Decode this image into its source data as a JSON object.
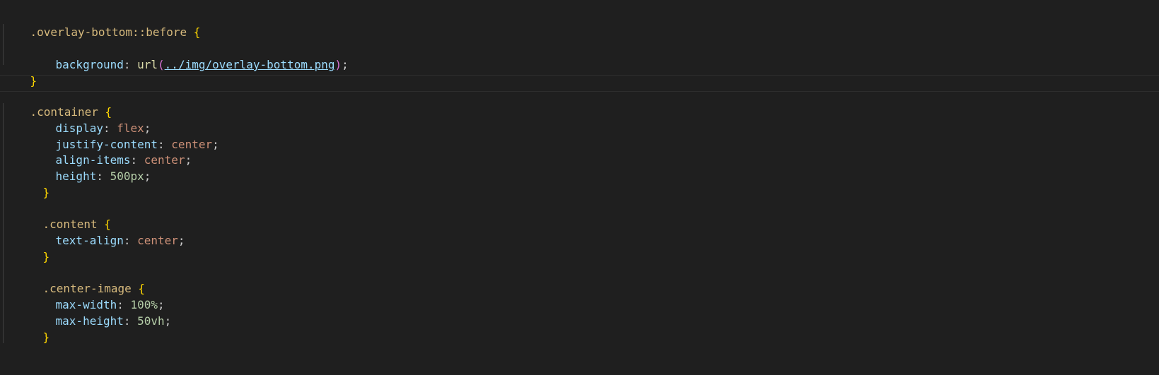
{
  "editor": {
    "blocks": {
      "overlay_bottom": {
        "selector": ".overlay-bottom::before",
        "open": "{",
        "close": "}",
        "decls": [
          {
            "prop": "background",
            "fn": "url",
            "arg": "../img/overlay-bottom.png"
          }
        ]
      },
      "container": {
        "selector": ".container",
        "open": "{",
        "close": "}",
        "decls": [
          {
            "prop": "display",
            "value": "flex"
          },
          {
            "prop": "justify-content",
            "value": "center"
          },
          {
            "prop": "align-items",
            "value": "center"
          },
          {
            "prop": "height",
            "value": "500px"
          }
        ]
      },
      "content": {
        "selector": ".content",
        "open": "{",
        "close": "}",
        "decls": [
          {
            "prop": "text-align",
            "value": "center"
          }
        ]
      },
      "center_image": {
        "selector": ".center-image",
        "open": "{",
        "close": "}",
        "decls": [
          {
            "prop": "max-width",
            "value": "100%"
          },
          {
            "prop": "max-height",
            "value": "50vh"
          }
        ]
      }
    },
    "colors": {
      "background": "#1f1f1f",
      "selector": "#d7ba7d",
      "brace": "#ffd700",
      "property": "#9cdcfe",
      "string_value": "#ce9178",
      "number_value": "#b5cea8",
      "function": "#dcdcaa",
      "paren": "#da70d6"
    }
  }
}
